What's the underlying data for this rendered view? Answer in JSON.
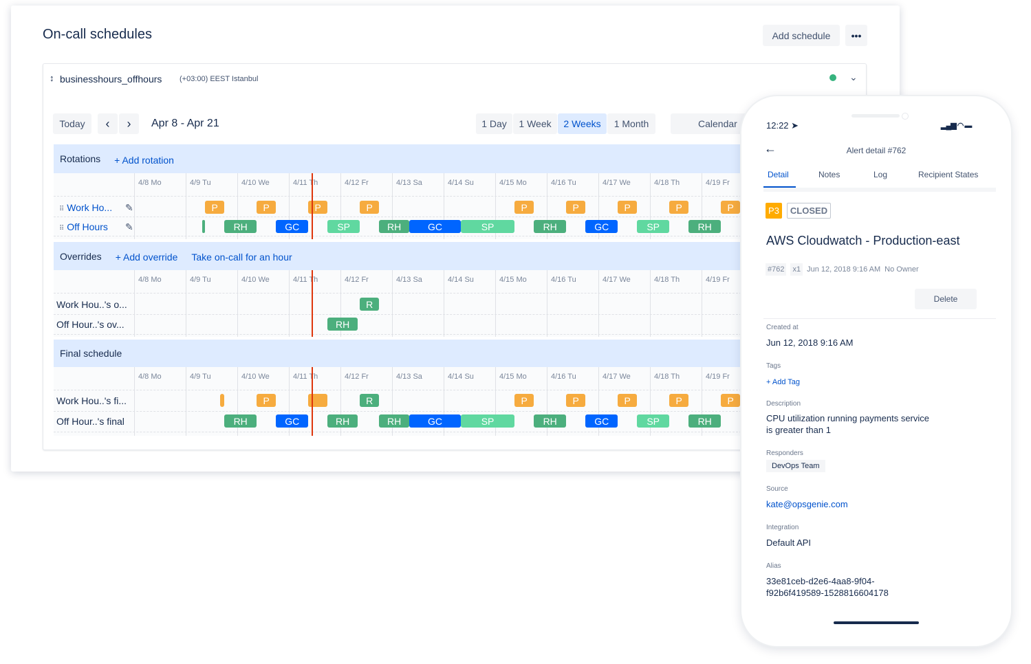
{
  "page": {
    "title": "On-call schedules",
    "add_schedule": "Add schedule",
    "more": "•••"
  },
  "schedule": {
    "name": "businesshours_offhours",
    "timezone": "(+03:00) EEST Istanbul",
    "status_color": "#36b37e"
  },
  "toolbar": {
    "today": "Today",
    "prev": "‹",
    "next": "›",
    "range": "Apr 8 - Apr 21",
    "views": [
      "1 Day",
      "1 Week",
      "2 Weeks",
      "1 Month"
    ],
    "active_view": "2 Weeks",
    "calendar": "Calendar"
  },
  "days": [
    "4/8 Mo",
    "4/9 Tu",
    "4/10 We",
    "4/11 Th",
    "4/12 Fr",
    "4/13 Sa",
    "4/14 Su",
    "4/15 Mo",
    "4/16 Tu",
    "4/17 We",
    "4/18 Th",
    "4/19 Fr"
  ],
  "today_marker": "4/11 11:00",
  "colors": {
    "P": "#f6ab3f",
    "RH": "#4caf7d",
    "GC": "#0065ff",
    "SP": "#60d8a0",
    "R": "#4caf7d"
  },
  "rotations": {
    "title": "Rotations",
    "add": "+ Add rotation",
    "rows": [
      {
        "name": "Work Ho...",
        "bars": [
          [
            "P",
            "4/9 09:00",
            "4/9 18:00"
          ],
          [
            "P",
            "4/10 09:00",
            "4/10 18:00"
          ],
          [
            "P",
            "4/11 09:00",
            "4/11 18:00"
          ],
          [
            "P",
            "4/12 09:00",
            "4/12 18:00"
          ],
          [
            "P",
            "4/15 09:00",
            "4/15 18:00"
          ],
          [
            "P",
            "4/16 09:00",
            "4/16 18:00"
          ],
          [
            "P",
            "4/17 09:00",
            "4/17 18:00"
          ],
          [
            "P",
            "4/18 09:00",
            "4/18 18:00"
          ],
          [
            "P",
            "4/19 09:00",
            "4/19 18:00"
          ]
        ]
      },
      {
        "name": "Off Hours",
        "bars": [
          [
            "RH",
            "4/9 07:50",
            "4/9 09:00",
            ""
          ],
          [
            "RH",
            "4/9 18:00",
            "4/10 09:00"
          ],
          [
            "GC",
            "4/10 18:00",
            "4/11 09:00"
          ],
          [
            "SP",
            "4/11 18:00",
            "4/12 09:00"
          ],
          [
            "RH",
            "4/12 18:00",
            "4/13 08:00"
          ],
          [
            "GC",
            "4/13 08:00",
            "4/14 08:00"
          ],
          [
            "SP",
            "4/14 08:00",
            "4/15 09:00"
          ],
          [
            "RH",
            "4/15 18:00",
            "4/16 09:00"
          ],
          [
            "GC",
            "4/16 18:00",
            "4/17 09:00"
          ],
          [
            "SP",
            "4/17 18:00",
            "4/18 09:00"
          ],
          [
            "RH",
            "4/18 18:00",
            "4/19 09:00"
          ]
        ]
      }
    ]
  },
  "overrides": {
    "title": "Overrides",
    "add": "+ Add override",
    "take": "Take on-call for an hour",
    "rows": [
      {
        "name": "Work Hou..'s o...",
        "bars": [
          [
            "R",
            "4/12 09:00",
            "4/12 18:00"
          ]
        ]
      },
      {
        "name": "Off Hour..'s ov...",
        "bars": [
          [
            "RH",
            "4/11 18:00",
            "4/12 08:00"
          ]
        ]
      }
    ]
  },
  "final": {
    "title": "Final schedule",
    "rows": [
      {
        "name": "Work Hou..'s fi...",
        "bars": [
          [
            "P",
            "4/9 16:00",
            "4/9 18:00",
            ""
          ],
          [
            "P",
            "4/10 09:00",
            "4/10 18:00"
          ],
          [
            "P",
            "4/11 09:00",
            "4/11 18:00",
            ""
          ],
          [
            "R",
            "4/12 09:00",
            "4/12 18:00"
          ],
          [
            "P",
            "4/15 09:00",
            "4/15 18:00"
          ],
          [
            "P",
            "4/16 09:00",
            "4/16 18:00"
          ],
          [
            "P",
            "4/17 09:00",
            "4/17 18:00"
          ],
          [
            "P",
            "4/18 09:00",
            "4/18 18:00"
          ],
          [
            "P",
            "4/19 09:00",
            "4/19 18:00"
          ]
        ]
      },
      {
        "name": "Off Hour..'s final",
        "bars": [
          [
            "RH",
            "4/9 18:00",
            "4/10 09:00"
          ],
          [
            "GC",
            "4/10 18:00",
            "4/11 09:00"
          ],
          [
            "RH",
            "4/11 18:00",
            "4/12 08:00"
          ],
          [
            "RH",
            "4/12 18:00",
            "4/13 08:00"
          ],
          [
            "GC",
            "4/13 08:00",
            "4/14 08:00"
          ],
          [
            "SP",
            "4/14 08:00",
            "4/15 09:00"
          ],
          [
            "RH",
            "4/15 18:00",
            "4/16 09:00"
          ],
          [
            "GC",
            "4/16 18:00",
            "4/17 09:00"
          ],
          [
            "SP",
            "4/17 18:00",
            "4/18 09:00"
          ],
          [
            "RH",
            "4/18 18:00",
            "4/19 09:00"
          ]
        ]
      }
    ]
  },
  "phone": {
    "time": "12:22",
    "header": "Alert detail #762",
    "tabs": [
      "Detail",
      "Notes",
      "Log",
      "Recipient States"
    ],
    "active_tab": "Detail",
    "priority": "P3",
    "status": "CLOSED",
    "title": "AWS Cloudwatch - Production-east",
    "id": "#762",
    "count": "x1",
    "date": "Jun 12, 2018 9:16 AM",
    "owner": "No Owner",
    "delete": "Delete",
    "created_label": "Created at",
    "created": "Jun 12, 2018 9:16 AM",
    "tags_label": "Tags",
    "add_tag": "+ Add Tag",
    "description_label": "Description",
    "description_1": "CPU utilization running payments service",
    "description_2": "is greater than 1",
    "responders_label": "Responders",
    "responder": "DevOps Team",
    "source_label": "Source",
    "source": "kate@opsgenie.com",
    "integration_label": "Integration",
    "integration": "Default API",
    "alias_label": "Alias",
    "alias_1": "33e81ceb-d2e6-4aa8-9f04-",
    "alias_2": "f92b6f419589-1528816604178"
  }
}
